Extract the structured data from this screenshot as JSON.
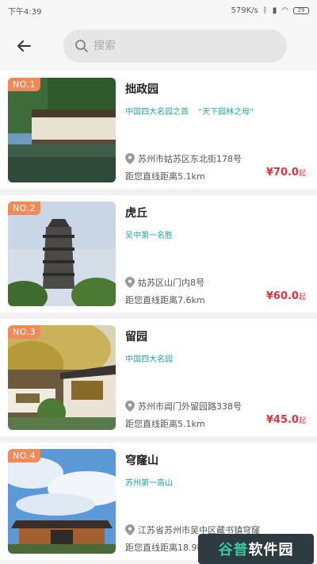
{
  "status_bar": {
    "time": "下午4:39",
    "network_speed": "579K/s",
    "battery": "29"
  },
  "search": {
    "placeholder": "搜索"
  },
  "items": [
    {
      "rank": "NO.1",
      "name": "拙政园",
      "tags": [
        "中国四大名园之首",
        "“天下园林之母”"
      ],
      "address": "苏州市姑苏区东北街178号",
      "distance": "距您直线距离5.1km",
      "price": "¥70.0",
      "price_unit": "起"
    },
    {
      "rank": "NO.2",
      "name": "虎丘",
      "tags": [
        "吴中第一名胜"
      ],
      "address": "姑苏区山门内8号",
      "distance": "距您直线距离7.6km",
      "price": "¥60.0",
      "price_unit": "起"
    },
    {
      "rank": "NO.3",
      "name": "留园",
      "tags": [
        "中国四大名园"
      ],
      "address": "苏州市阊门外留园路338号",
      "distance": "距您直线距离5.1km",
      "price": "¥45.0",
      "price_unit": "起"
    },
    {
      "rank": "NO.4",
      "name": "穹窿山",
      "tags": [
        "苏州第一高山"
      ],
      "address": "江苏省苏州市吴中区藏书镇穹窿",
      "distance": "距您直线距离18.9km",
      "price": "",
      "price_unit": ""
    }
  ],
  "watermark": {
    "part1": "谷普",
    "part2": "软件园"
  }
}
